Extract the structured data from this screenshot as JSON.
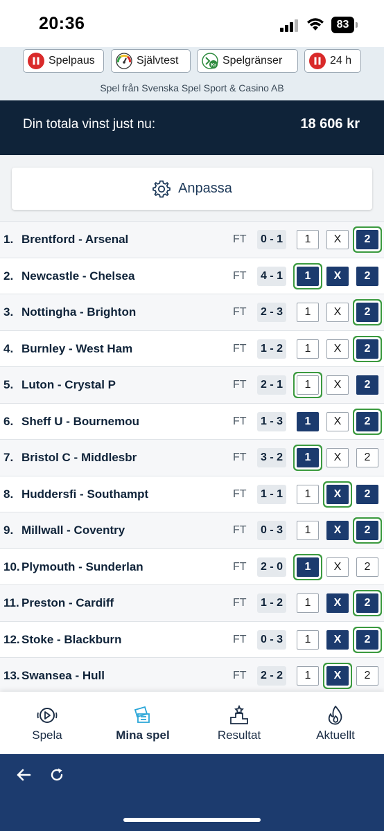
{
  "status_bar": {
    "time": "20:36",
    "battery": "83"
  },
  "responsible_gaming": {
    "buttons": [
      {
        "label": "Spelpaus",
        "icon": "pause-icon"
      },
      {
        "label": "Självtest",
        "icon": "gauge-icon"
      },
      {
        "label": "Spelgränser",
        "icon": "limit-icon"
      },
      {
        "label": "24 h",
        "icon": "pause-icon"
      }
    ],
    "caption": "Spel från Svenska Spel Sport & Casino AB"
  },
  "winnings": {
    "label": "Din totala vinst just nu:",
    "value": "18 606 kr"
  },
  "customize_label": "Anpassa",
  "options": [
    "1",
    "X",
    "2"
  ],
  "matches": [
    {
      "num": "1.",
      "teams": "Brentford - Arsenal",
      "status": "FT",
      "score": "0 - 1",
      "picks": [
        "2"
      ],
      "correct": "2"
    },
    {
      "num": "2.",
      "teams": "Newcastle - Chelsea",
      "status": "FT",
      "score": "4 - 1",
      "picks": [
        "1",
        "X",
        "2"
      ],
      "correct": "1"
    },
    {
      "num": "3.",
      "teams": "Nottingha - Brighton",
      "status": "FT",
      "score": "2 - 3",
      "picks": [
        "2"
      ],
      "correct": "2"
    },
    {
      "num": "4.",
      "teams": "Burnley - West Ham",
      "status": "FT",
      "score": "1 - 2",
      "picks": [
        "2"
      ],
      "correct": "2"
    },
    {
      "num": "5.",
      "teams": "Luton - Crystal P",
      "status": "FT",
      "score": "2 - 1",
      "picks": [
        "2"
      ],
      "correct": "1"
    },
    {
      "num": "6.",
      "teams": "Sheff U - Bournemou",
      "status": "FT",
      "score": "1 - 3",
      "picks": [
        "1",
        "2"
      ],
      "correct": "2"
    },
    {
      "num": "7.",
      "teams": "Bristol C - Middlesbr",
      "status": "FT",
      "score": "3 - 2",
      "picks": [
        "1"
      ],
      "correct": "1"
    },
    {
      "num": "8.",
      "teams": "Huddersfi - Southampt",
      "status": "FT",
      "score": "1 - 1",
      "picks": [
        "X",
        "2"
      ],
      "correct": "X"
    },
    {
      "num": "9.",
      "teams": "Millwall - Coventry",
      "status": "FT",
      "score": "0 - 3",
      "picks": [
        "X",
        "2"
      ],
      "correct": "2"
    },
    {
      "num": "10.",
      "teams": "Plymouth - Sunderlan",
      "status": "FT",
      "score": "2 - 0",
      "picks": [
        "1"
      ],
      "correct": "1"
    },
    {
      "num": "11.",
      "teams": "Preston - Cardiff",
      "status": "FT",
      "score": "1 - 2",
      "picks": [
        "X",
        "2"
      ],
      "correct": "2"
    },
    {
      "num": "12.",
      "teams": "Stoke - Blackburn",
      "status": "FT",
      "score": "0 - 3",
      "picks": [
        "X",
        "2"
      ],
      "correct": "2"
    },
    {
      "num": "13.",
      "teams": "Swansea - Hull",
      "status": "FT",
      "score": "2 - 2",
      "picks": [
        "X"
      ],
      "correct": "X"
    }
  ],
  "bottom_nav": [
    {
      "label": "Spela",
      "icon": "play-icon",
      "active": false
    },
    {
      "label": "Mina spel",
      "icon": "tickets-icon",
      "active": true
    },
    {
      "label": "Resultat",
      "icon": "podium-icon",
      "active": false
    },
    {
      "label": "Aktuellt",
      "icon": "flame-icon",
      "active": false
    }
  ],
  "colors": {
    "navy": "#0f2339",
    "selected": "#1c3b6e",
    "correct_outline": "#3b9a3f",
    "accent_light_blue": "#2aa6d8",
    "pause_red": "#d92a2a"
  }
}
